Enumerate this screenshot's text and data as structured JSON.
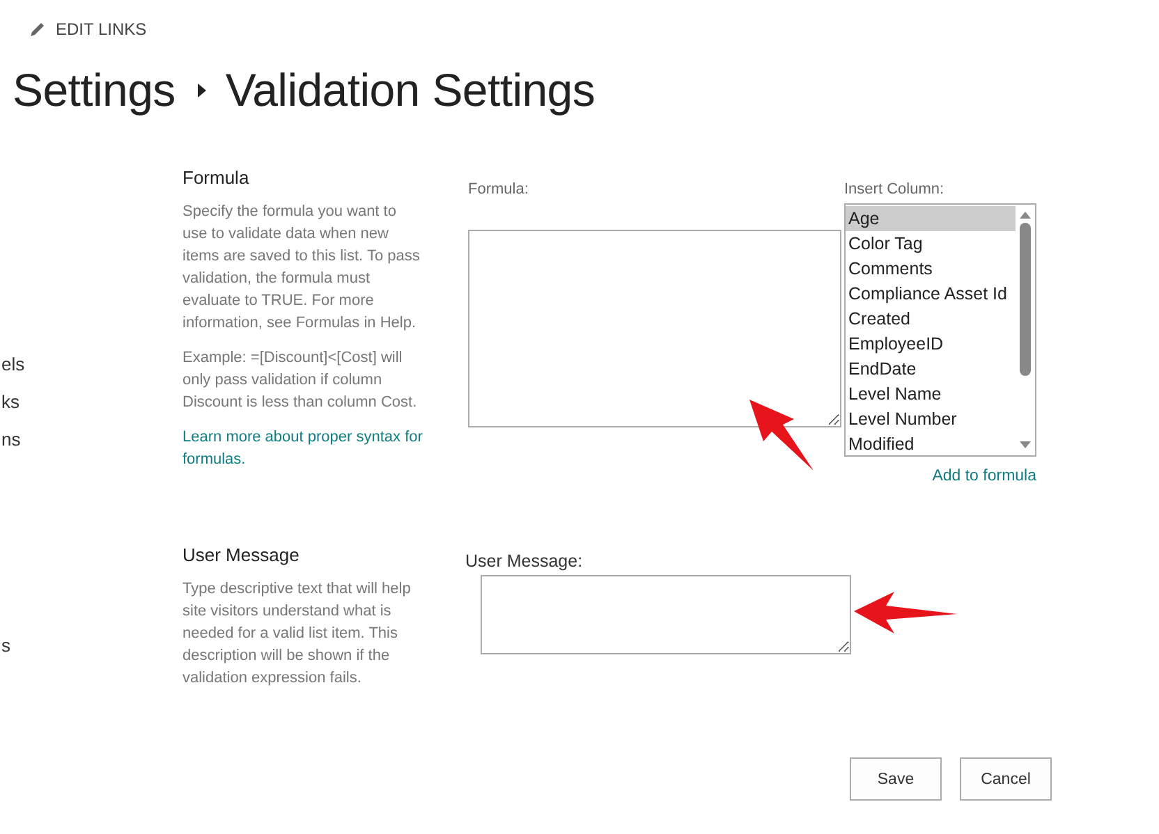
{
  "top_link": {
    "label": "EDIT LINKS"
  },
  "breadcrumb": [
    {
      "label": "Settings"
    },
    {
      "label": "Validation Settings"
    }
  ],
  "sidebar": {
    "items": [
      {
        "label": "els"
      },
      {
        "label": "ks"
      },
      {
        "label": "ns"
      },
      {
        "label": "s"
      }
    ]
  },
  "formula_section": {
    "heading": "Formula",
    "description": "Specify the formula you want to use to validate data when new items are saved to this list. To pass validation, the formula must evaluate to TRUE. For more information, see Formulas in Help.",
    "example": "Example: =[Discount]<[Cost] will only pass validation if column Discount is less than column Cost.",
    "link": "Learn more about proper syntax for formulas.",
    "field_label": "Formula:",
    "column_label": "Insert Column:",
    "columns": [
      {
        "label": "Age",
        "selected": true
      },
      {
        "label": "Color Tag",
        "selected": false
      },
      {
        "label": "Comments",
        "selected": false
      },
      {
        "label": "Compliance Asset Id",
        "selected": false
      },
      {
        "label": "Created",
        "selected": false
      },
      {
        "label": "EmployeeID",
        "selected": false
      },
      {
        "label": "EndDate",
        "selected": false
      },
      {
        "label": "Level Name",
        "selected": false
      },
      {
        "label": "Level Number",
        "selected": false
      },
      {
        "label": "Modified",
        "selected": false
      }
    ],
    "add_link": "Add to formula"
  },
  "message_section": {
    "heading": "User Message",
    "description": "Type descriptive text that will help site visitors understand what is needed for a valid list item. This description will be shown if the validation expression fails.",
    "field_label": "User Message:"
  },
  "buttons": [
    {
      "label": "Save"
    },
    {
      "label": "Cancel"
    }
  ]
}
